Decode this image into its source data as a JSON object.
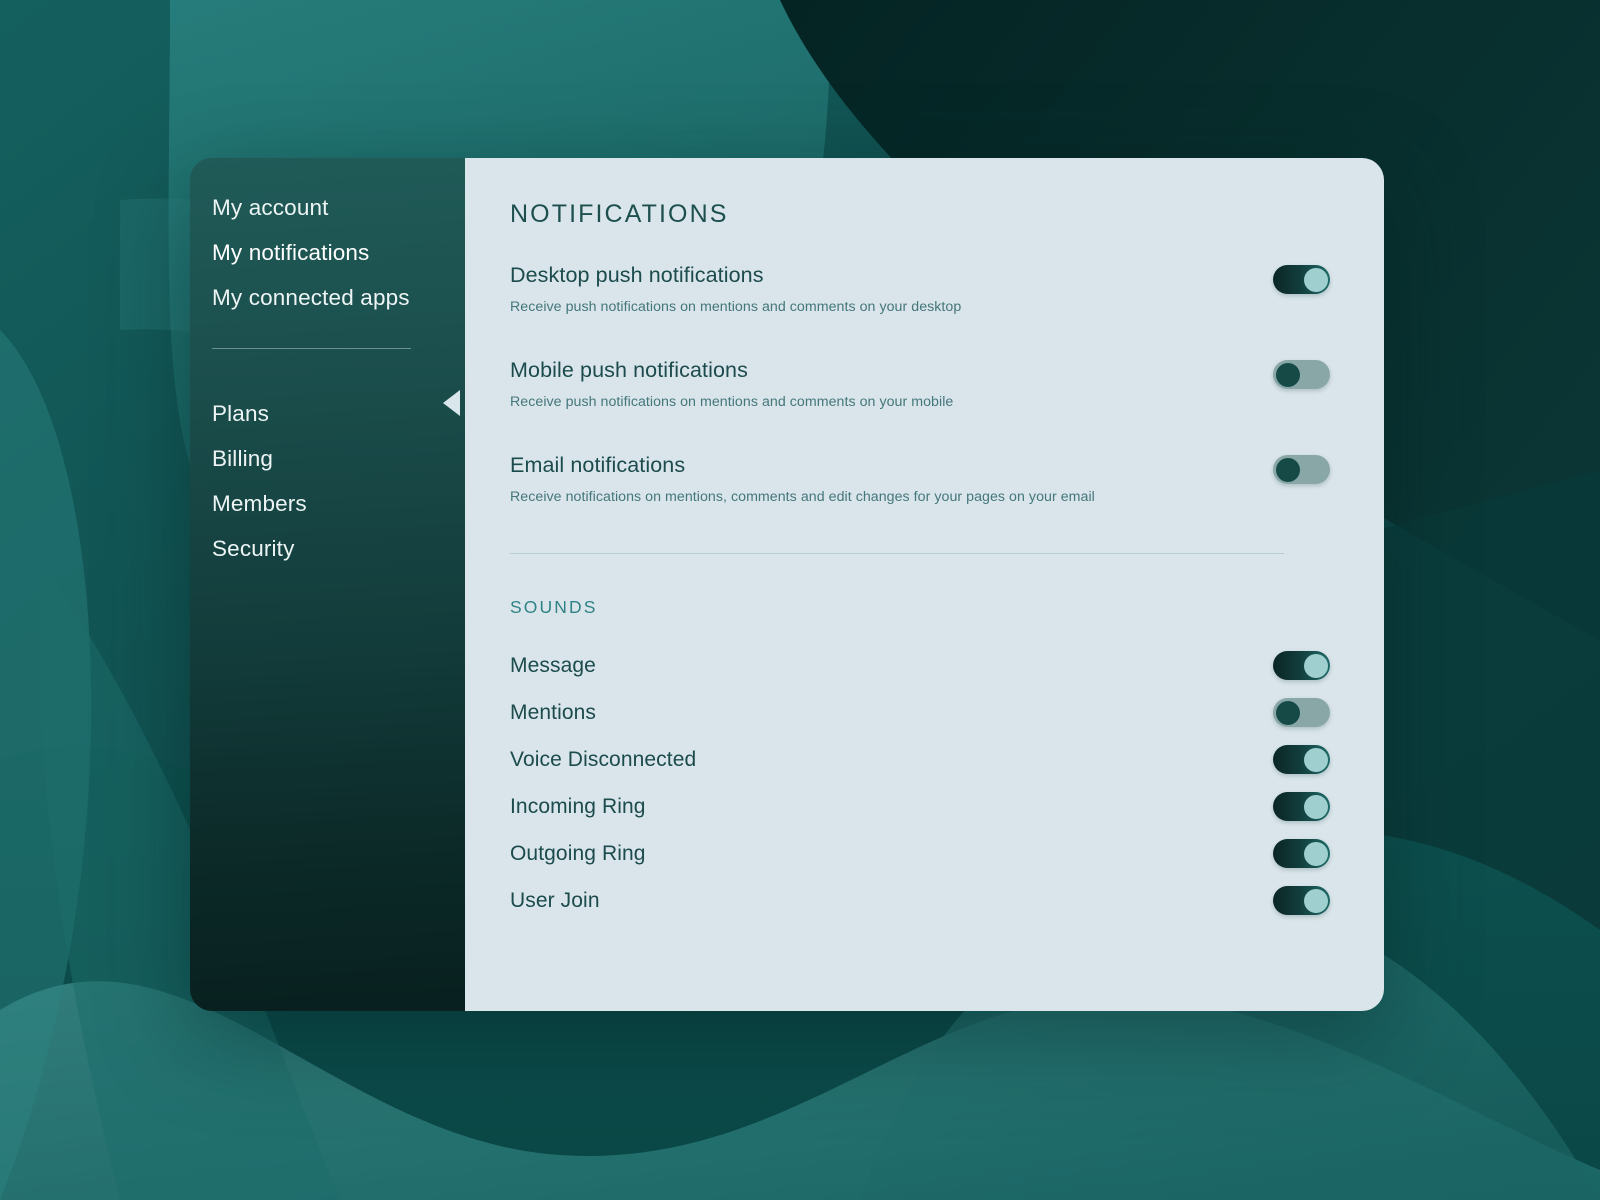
{
  "sidebar": {
    "primary_items": [
      {
        "label": "My account",
        "active": false
      },
      {
        "label": "My notifications",
        "active": true
      },
      {
        "label": "My connected apps",
        "active": false
      }
    ],
    "secondary_items": [
      {
        "label": "Plans"
      },
      {
        "label": "Billing"
      },
      {
        "label": "Members"
      },
      {
        "label": "Security"
      }
    ]
  },
  "panel": {
    "notifications_heading": "NOTIFICATIONS",
    "notification_rows": [
      {
        "label": "Desktop push notifications",
        "description": "Receive push notifications on mentions and comments on your desktop",
        "state": "on"
      },
      {
        "label": "Mobile push notifications",
        "description": "Receive push notifications on mentions and comments on your mobile",
        "state": "off"
      },
      {
        "label": "Email notifications",
        "description": "Receive notifications on mentions, comments and edit changes for your pages on your email",
        "state": "off"
      }
    ],
    "sounds_heading": "SOUNDS",
    "sound_rows": [
      {
        "label": "Message",
        "state": "on"
      },
      {
        "label": "Mentions",
        "state": "off"
      },
      {
        "label": "Voice Disconnected",
        "state": "on"
      },
      {
        "label": "Incoming Ring",
        "state": "on"
      },
      {
        "label": "Outgoing Ring",
        "state": "on"
      },
      {
        "label": "User Join",
        "state": "on"
      }
    ]
  },
  "theme": {
    "panel_background": "#d9e5ea",
    "sidebar_top": "#205b58",
    "sidebar_bottom": "#08201f",
    "accent_teal": "#2f8386",
    "heading_teal": "#1d4f4f",
    "toggle_on_knob": "#9fd0cf",
    "toggle_off_track": "#8aa7a8",
    "toggle_off_knob": "#154a47",
    "background_deep": "#0b3f3f"
  }
}
